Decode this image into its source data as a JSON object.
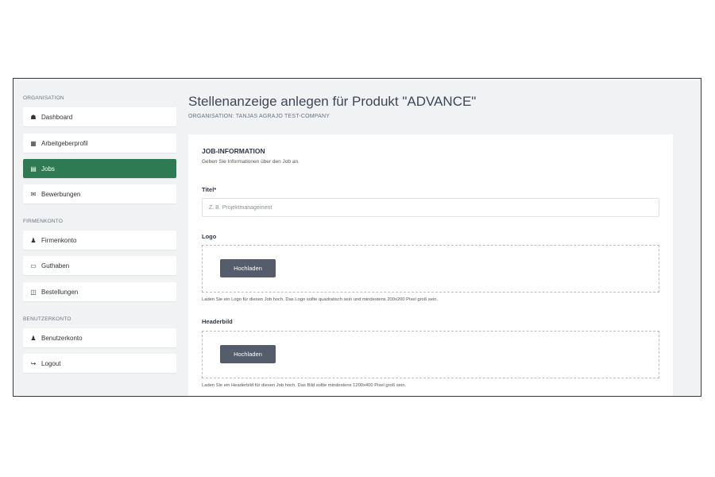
{
  "sidebar": {
    "sections": [
      {
        "label": "ORGANISATION",
        "items": [
          {
            "label": "Dashboard",
            "icon": "home-icon"
          },
          {
            "label": "Arbeitgeberprofil",
            "icon": "building-icon"
          },
          {
            "label": "Jobs",
            "icon": "document-icon",
            "active": true
          },
          {
            "label": "Bewerbungen",
            "icon": "envelope-icon"
          }
        ]
      },
      {
        "label": "FIRMENKONTO",
        "items": [
          {
            "label": "Firmenkonto",
            "icon": "users-icon"
          },
          {
            "label": "Guthaben",
            "icon": "wallet-icon"
          },
          {
            "label": "Bestellungen",
            "icon": "cart-icon"
          }
        ]
      },
      {
        "label": "BENUTZERKONTO",
        "items": [
          {
            "label": "Benutzerkonto",
            "icon": "user-icon"
          },
          {
            "label": "Logout",
            "icon": "logout-icon"
          }
        ]
      }
    ]
  },
  "header": {
    "title": "Stellenanzeige anlegen für Produkt \"ADVANCE\"",
    "subtitle": "ORGANISATION: TANJAS AGRAJO TEST-COMPANY"
  },
  "form": {
    "section_title": "JOB-INFORMATION",
    "section_desc": "Geben Sie Informationen über den Job an.",
    "title_label": "Titel*",
    "title_placeholder": "Z. B. Projektmanagement",
    "logo_label": "Logo",
    "logo_button": "Hochladen",
    "logo_hint": "Laden Sie ein Logo für diesen Job hoch. Das Logo sollte quadratisch sein und mindestens 200x200 Pixel groß sein.",
    "header_label": "Headerbild",
    "header_button": "Hochladen",
    "header_hint": "Laden Sie ein Headerbild für diesen Job hoch. Das Bild sollte mindestens 1200x400 Pixel groß sein."
  },
  "colors": {
    "active": "#2e7a52",
    "button": "#555c6b"
  }
}
